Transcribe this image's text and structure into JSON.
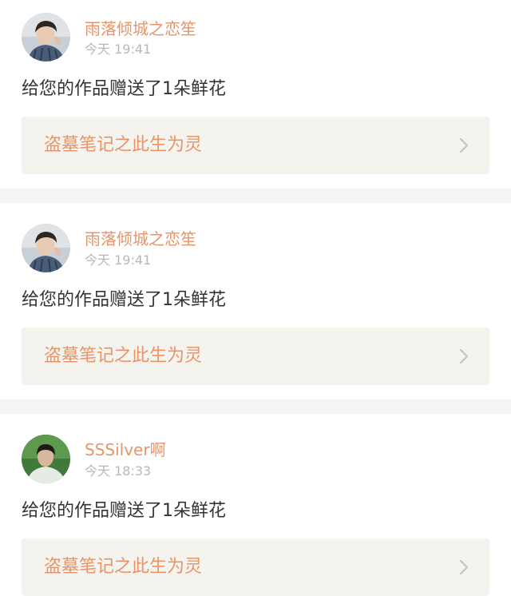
{
  "notifications": [
    {
      "username": "雨落倾城之恋笙",
      "time": "今天 19:41",
      "message": "给您的作品赠送了1朵鲜花",
      "work_title": "盗墓笔记之此生为灵",
      "avatar": "avatar-man-checked-shirt"
    },
    {
      "username": "雨落倾城之恋笙",
      "time": "今天 19:41",
      "message": "给您的作品赠送了1朵鲜花",
      "work_title": "盗墓笔记之此生为灵",
      "avatar": "avatar-man-checked-shirt"
    },
    {
      "username": "SSSilver啊",
      "time": "今天 18:33",
      "message": "给您的作品赠送了1朵鲜花",
      "work_title": "盗墓笔记之此生为灵",
      "avatar": "avatar-person-green-background"
    }
  ],
  "colors": {
    "accent": "#e6956a",
    "timestamp": "#b8b8b8",
    "text": "#333333",
    "link_background": "#f4f3ee",
    "separator": "#f5f4f2"
  },
  "icons": {
    "chevron": "chevron-right-icon"
  }
}
